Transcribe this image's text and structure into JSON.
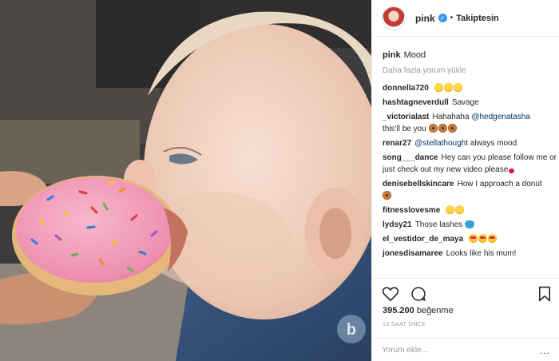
{
  "post": {
    "username": "pink",
    "follow_status": "Takiptesin",
    "caption_user": "pink",
    "caption_text": "Mood",
    "load_more": "Daha fazla yorum yükle",
    "likes_count": "395.200",
    "likes_label": "beğenme",
    "time_ago": "13 SAAT ÖNCE",
    "comment_placeholder": "Yorum ekle...",
    "more_options": "..."
  },
  "comments": [
    {
      "user": "donnella720",
      "text": "",
      "emoji": [
        "laugh",
        "laugh",
        "laugh"
      ]
    },
    {
      "user": "hashtagneverdull",
      "text": "Savage"
    },
    {
      "user": "_victorialast",
      "text": "Hahahaha",
      "mention": "@hedgenatasha",
      "text2": "this'll be you",
      "emoji": [
        "donut",
        "donut",
        "donut"
      ]
    },
    {
      "user": "renar27",
      "mention": "@stellathought",
      "text": "always mood"
    },
    {
      "user": "song___dance",
      "text": "Hey can you please follow me or just check out my new video please"
    },
    {
      "user": "denisebellskincare",
      "text": "How I approach a donut"
    },
    {
      "user": "fitnesslovesme",
      "text": ""
    },
    {
      "user": "lydsy21",
      "text": "Those lashes"
    },
    {
      "user": "el_vestidor_de_maya",
      "text": ""
    },
    {
      "user": "jonesdisamaree",
      "text": "Looks like his mum!"
    }
  ],
  "colors": {
    "verified": "#3897f0",
    "mention": "#003569",
    "muted": "#999999",
    "frosting": "#f29bb8"
  },
  "icons": [
    "heart-icon",
    "comment-icon",
    "bookmark-icon",
    "verified-badge-icon",
    "more-options-icon"
  ]
}
